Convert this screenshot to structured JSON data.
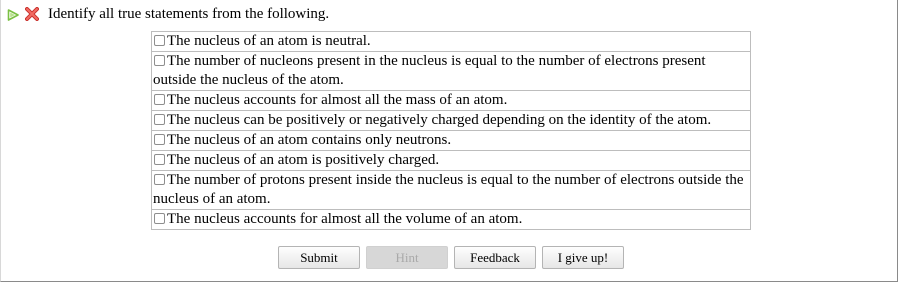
{
  "header": {
    "play_icon": "play-triangle-icon",
    "play_color": "#7bc043",
    "close_icon": "red-x-icon",
    "close_color": "#e0403a",
    "question": "Identify all true statements from the following."
  },
  "options": [
    {
      "text": "The nucleus of an atom is neutral.",
      "checked": false
    },
    {
      "text": "The number of nucleons present in the nucleus is equal to the number of electrons present outside the nucleus of the atom.",
      "checked": false
    },
    {
      "text": "The nucleus accounts for almost all the mass of an atom.",
      "checked": false
    },
    {
      "text": "The nucleus can be positively or negatively charged depending on the identity of the atom.",
      "checked": false
    },
    {
      "text": "The nucleus of an atom contains only neutrons.",
      "checked": false
    },
    {
      "text": "The nucleus of an atom is positively charged.",
      "checked": false
    },
    {
      "text": "The number of protons present inside the nucleus is equal to the number of electrons outside the nucleus of an atom.",
      "checked": false
    },
    {
      "text": "The nucleus accounts for almost all the volume of an atom.",
      "checked": false
    }
  ],
  "buttons": {
    "submit": "Submit",
    "hint": "Hint",
    "hint_disabled": true,
    "feedback": "Feedback",
    "give_up": "I give up!"
  }
}
